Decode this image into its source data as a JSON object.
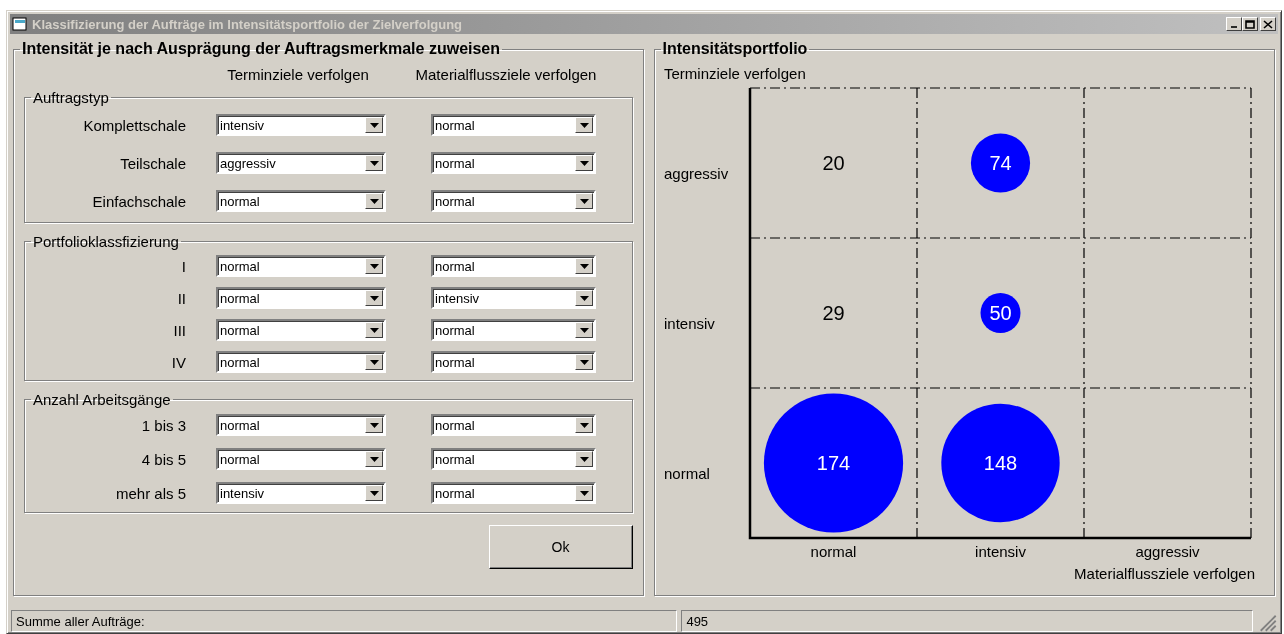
{
  "window": {
    "title": "Klassifizierung der Aufträge im Intensitätsportfolio der Zielverfolgung",
    "active": false
  },
  "assign": {
    "title": "Intensität je nach Ausprägung der Auftragsmerkmale zuweisen",
    "columns": [
      "Terminziele verfolgen",
      "Materialflussziele verfolgen"
    ],
    "groups": [
      {
        "title": "Auftragstyp",
        "rows": [
          {
            "label": "Komplettschale",
            "values": [
              "intensiv",
              "normal"
            ]
          },
          {
            "label": "Teilschale",
            "values": [
              "aggressiv",
              "normal"
            ]
          },
          {
            "label": "Einfachschale",
            "values": [
              "normal",
              "normal"
            ]
          }
        ]
      },
      {
        "title": "Portfolioklassfizierung",
        "rows": [
          {
            "label": "I",
            "values": [
              "normal",
              "normal"
            ]
          },
          {
            "label": "II",
            "values": [
              "normal",
              "intensiv"
            ]
          },
          {
            "label": "III",
            "values": [
              "normal",
              "normal"
            ]
          },
          {
            "label": "IV",
            "values": [
              "normal",
              "normal"
            ]
          }
        ]
      },
      {
        "title": "Anzahl Arbeitsgänge",
        "rows": [
          {
            "label": "1 bis 3",
            "values": [
              "normal",
              "normal"
            ]
          },
          {
            "label": "4 bis 5",
            "values": [
              "normal",
              "normal"
            ]
          },
          {
            "label": "mehr als 5",
            "values": [
              "intensiv",
              "normal"
            ]
          }
        ]
      }
    ],
    "ok_button": "Ok"
  },
  "portfolio": {
    "title": "Intensitätsportfolio",
    "y_axis_title": "Terminziele verfolgen",
    "x_axis_title": "Materialflussziele verfolgen",
    "row_labels": [
      "aggressiv",
      "intensiv",
      "normal"
    ],
    "column_labels": [
      "normal",
      "intensiv",
      "aggressiv"
    ],
    "rows": [
      {
        "cells": [
          {
            "kind": "text",
            "value": "20"
          },
          {
            "kind": "bubble",
            "value": "74"
          },
          {
            "kind": "empty"
          }
        ]
      },
      {
        "cells": [
          {
            "kind": "text",
            "value": "29"
          },
          {
            "kind": "bubble",
            "value": "50"
          },
          {
            "kind": "empty"
          }
        ]
      },
      {
        "cells": [
          {
            "kind": "bubble",
            "value": "174"
          },
          {
            "kind": "bubble",
            "value": "148"
          },
          {
            "kind": "empty"
          }
        ]
      }
    ]
  },
  "status_bar": {
    "label": "Summe aller Aufträge:",
    "value": "495"
  }
}
